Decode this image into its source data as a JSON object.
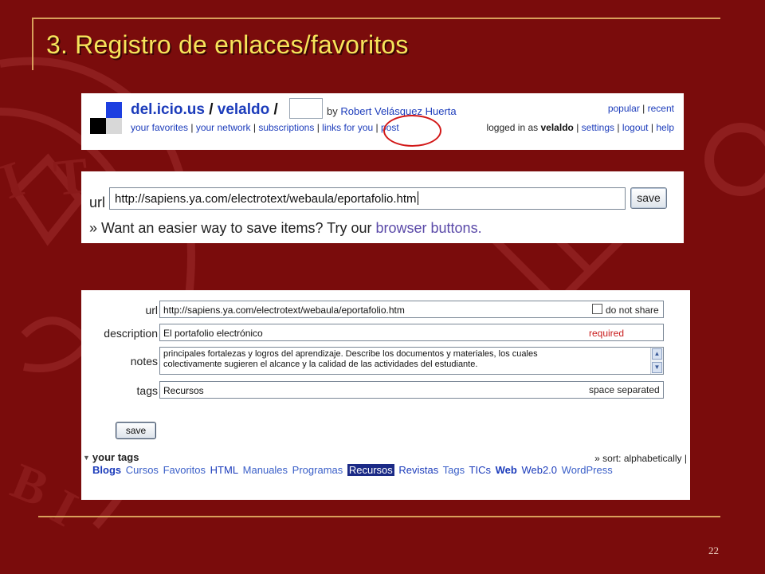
{
  "slide": {
    "title": "3. Registro de enlaces/favoritos",
    "page_number": "22",
    "colors": {
      "background": "#7a0c0c",
      "title": "#f6e45a",
      "rule": "#d9a05b"
    }
  },
  "header_panel": {
    "site_name": "del.icio.us",
    "separator": "/",
    "username": "velaldo",
    "by_label": "by",
    "full_name": "Robert Velásquez Huerta",
    "top_links": [
      "popular",
      "recent"
    ],
    "nav_links": [
      "your favorites",
      "your network",
      "subscriptions",
      "links for you",
      "post"
    ],
    "logged_in_label": "logged in as",
    "logged_in_user": "velaldo",
    "account_links": [
      "settings",
      "logout",
      "help"
    ]
  },
  "url_panel": {
    "label": "url",
    "value": "http://sapiens.ya.com/electrotext/webaula/eportafolio.htm",
    "save_label": "save",
    "hint_prefix": "» Want an easier way to save items? Try our",
    "hint_link": "browser buttons."
  },
  "form_panel": {
    "url_label": "url",
    "url_value": "http://sapiens.ya.com/electrotext/webaula/eportafolio.htm",
    "do_not_share_label": "do not share",
    "description_label": "description",
    "description_value": "El portafolio electrónico",
    "required_label": "required",
    "notes_label": "notes",
    "notes_lines": [
      "principales fortalezas y logros del aprendizaje.  Describe los documentos y materiales, los cuales",
      "colectivamente sugieren el alcance y la calidad de las actividades del estudiante."
    ],
    "tags_label": "tags",
    "tags_value": "Recursos",
    "tags_hint": "space separated",
    "save_label": "save",
    "your_tags_label": "your tags",
    "sort_label": "» sort: alphabetically |",
    "tags": [
      {
        "label": "Blogs"
      },
      {
        "label": "Cursos"
      },
      {
        "label": "Favoritos"
      },
      {
        "label": "HTML"
      },
      {
        "label": "Manuales"
      },
      {
        "label": "Programas"
      },
      {
        "label": "Recursos"
      },
      {
        "label": "Revistas"
      },
      {
        "label": "Tags"
      },
      {
        "label": "TICs"
      },
      {
        "label": "Web"
      },
      {
        "label": "Web2.0"
      },
      {
        "label": "WordPress"
      }
    ]
  }
}
